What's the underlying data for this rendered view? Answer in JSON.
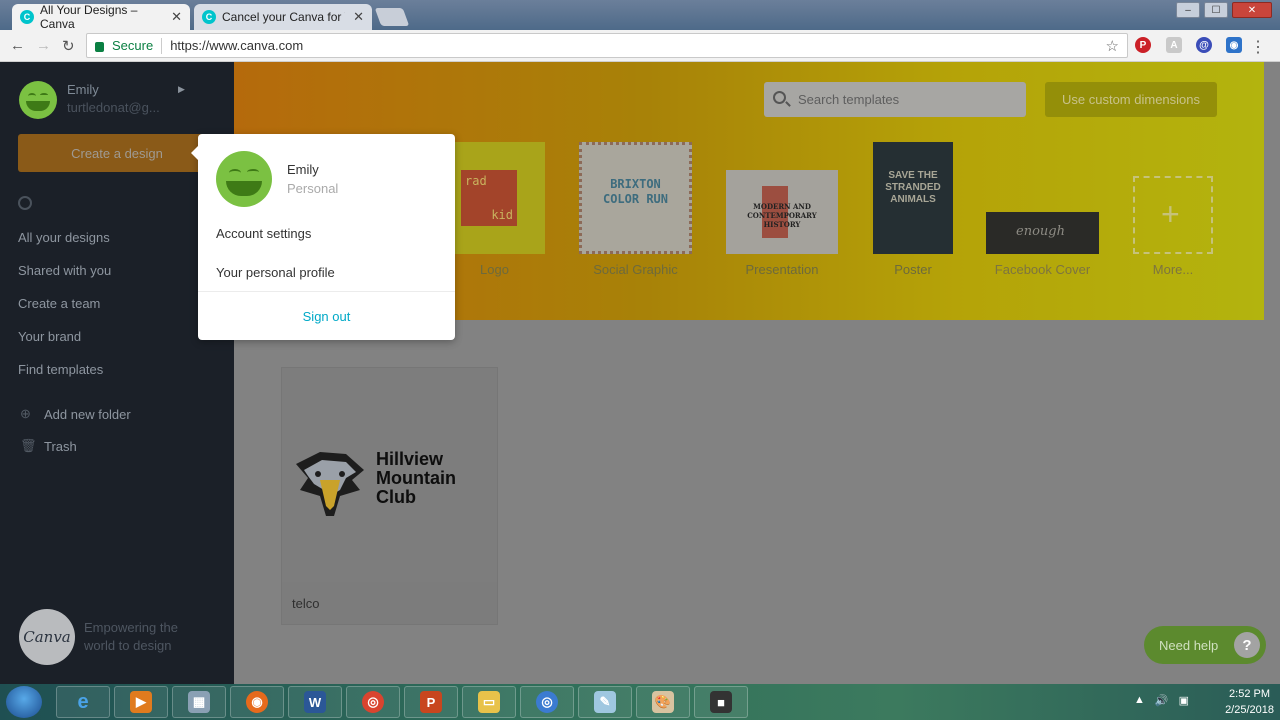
{
  "browser": {
    "tabs": [
      {
        "title": "All Your Designs – Canva",
        "favicon": "C",
        "active": true
      },
      {
        "title": "Cancel your Canva for W",
        "favicon": "C",
        "active": false
      }
    ],
    "secure_label": "Secure",
    "url": "https://www.canva.com",
    "window_controls": {
      "minimize": "‒",
      "maximize": "☐",
      "close": "✕"
    }
  },
  "sidebar": {
    "user_name": "Emily",
    "user_email": "turtledonat@g...",
    "create_button": "Create a design",
    "nav": [
      {
        "label": "All your designs"
      },
      {
        "label": "Shared with you"
      },
      {
        "label": "Create a team"
      },
      {
        "label": "Your brand"
      },
      {
        "label": "Find templates"
      }
    ],
    "add_folder": "Add new folder",
    "trash": "Trash",
    "logo_text": "Canva",
    "tagline": "Empowering the world to design"
  },
  "banner": {
    "search_placeholder": "Search templates",
    "custom_dimensions": "Use custom dimensions",
    "templates": [
      {
        "label": "Logo",
        "thumb_text": [
          "rad",
          "kid"
        ]
      },
      {
        "label": "Social Graphic",
        "thumb_text": [
          "BRIXTON",
          "COLOR RUN"
        ]
      },
      {
        "label": "Presentation",
        "thumb_text": [
          "MODERN AND",
          "CONTEMPORARY",
          "HISTORY"
        ]
      },
      {
        "label": "Poster",
        "thumb_text": [
          "SAVE THE",
          "STRANDED",
          "ANIMALS"
        ]
      },
      {
        "label": "Facebook Cover",
        "thumb_text": [
          "enough"
        ]
      },
      {
        "label": "More..."
      }
    ]
  },
  "designs": [
    {
      "title": "telco",
      "thumb_text": [
        "Hillview",
        "Mountain",
        "Club"
      ]
    }
  ],
  "help": {
    "label": "Need help",
    "icon": "?"
  },
  "account_popup": {
    "name": "Emily",
    "plan": "Personal",
    "items": [
      "Account settings",
      "Your personal profile"
    ],
    "sign_out": "Sign out"
  },
  "taskbar": {
    "time": "2:52 PM",
    "date": "2/25/2018"
  }
}
